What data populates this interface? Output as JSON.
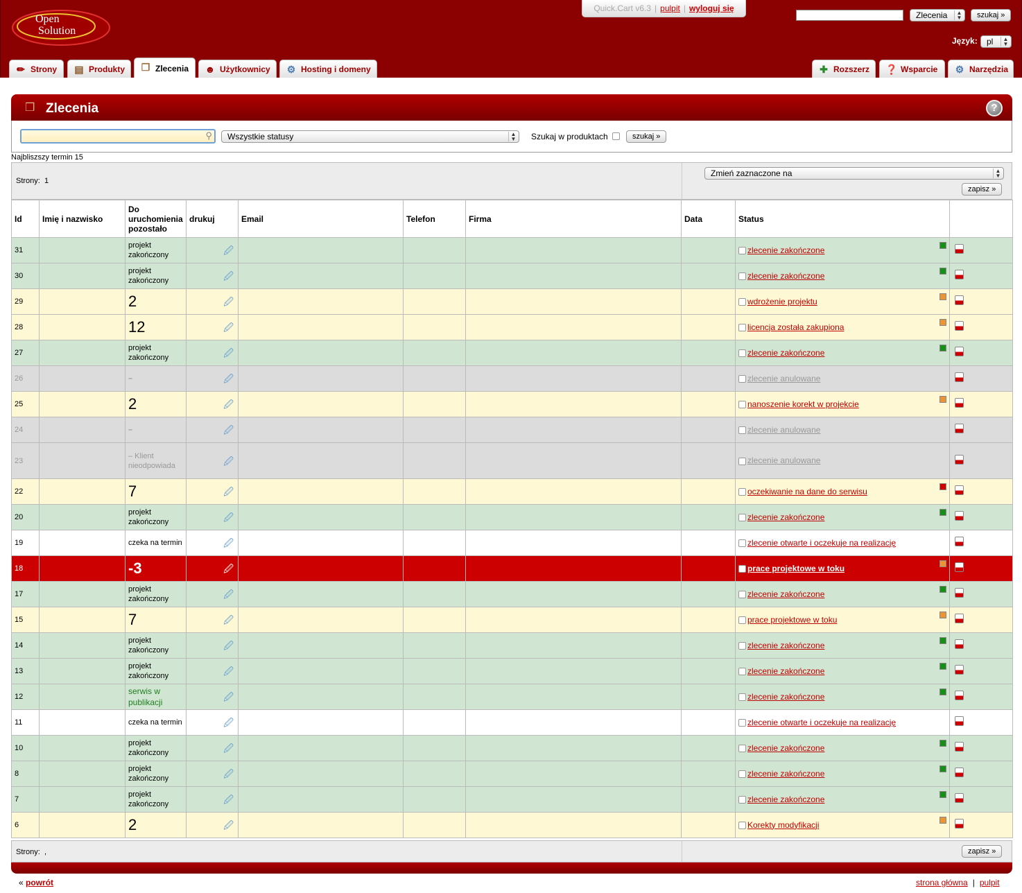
{
  "header": {
    "logo_text": "Open Solution",
    "version_bar": {
      "version": "Quick.Cart v6.3",
      "pulpit": "pulpit",
      "logout": "wyloguj się"
    },
    "search_select": "Zlecenia",
    "search_button": "szukaj »",
    "language_label": "Język:",
    "language_value": "pl"
  },
  "tabs_left": [
    {
      "label": "Strony",
      "icon": "pencil-icon"
    },
    {
      "label": "Produkty",
      "icon": "box-icon"
    },
    {
      "label": "Zlecenia",
      "icon": "package-icon",
      "active": true
    },
    {
      "label": "Użytkownicy",
      "icon": "user-icon"
    },
    {
      "label": "Hosting i domeny",
      "icon": "gears-icon"
    }
  ],
  "tabs_right": [
    {
      "label": "Rozszerz",
      "icon": "puzzle-icon"
    },
    {
      "label": "Wsparcie",
      "icon": "help-icon"
    },
    {
      "label": "Narzędzia",
      "icon": "tools-icon"
    }
  ],
  "panel": {
    "title": "Zlecenia",
    "help": "?",
    "filter": {
      "search_value": "",
      "status_select": "Wszystkie statusy",
      "search_in_products_label": "Szukaj w produktach",
      "search_button": "szukaj »"
    },
    "nearest_deadline": "Najbliszszy termin 15",
    "pages_label": "Strony:",
    "pages_value": "1",
    "pages_bottom_value": ",",
    "change_selected": "Zmień zaznaczone na",
    "save_button": "zapisz »"
  },
  "table": {
    "headers": {
      "id": "Id",
      "name": "Imię i nazwisko",
      "remaining": "Do uruchomienia pozostało",
      "print": "drukuj",
      "email": "Email",
      "phone": "Telefon",
      "company": "Firma",
      "date": "Data",
      "status": "Status"
    },
    "rows": [
      {
        "id": "31",
        "remaining": "projekt zakończony",
        "kind": "text",
        "status": "zlecenie zakończone",
        "color": "#1a8c1a",
        "row": "g"
      },
      {
        "id": "30",
        "remaining": "projekt zakończony",
        "kind": "text",
        "status": "zlecenie zakończone",
        "color": "#1a8c1a",
        "row": "g"
      },
      {
        "id": "29",
        "remaining": "2",
        "kind": "big",
        "status": "wdrożenie projektu",
        "color": "#e8953a",
        "row": "y"
      },
      {
        "id": "28",
        "remaining": "12",
        "kind": "big",
        "status": "licencja została zakupiona",
        "color": "#e8953a",
        "row": "y"
      },
      {
        "id": "27",
        "remaining": "projekt zakończony",
        "kind": "text",
        "status": "zlecenie zakończone",
        "color": "#1a8c1a",
        "row": "g"
      },
      {
        "id": "26",
        "remaining": "–",
        "kind": "dash",
        "status": "zlecenie anulowane",
        "color": "",
        "row": "x"
      },
      {
        "id": "25",
        "remaining": "2",
        "kind": "big",
        "status": "nanoszenie korekt w projekcie",
        "color": "#e8953a",
        "row": "y"
      },
      {
        "id": "24",
        "remaining": "–",
        "kind": "dash",
        "status": "zlecenie anulowane",
        "color": "",
        "row": "x"
      },
      {
        "id": "23",
        "remaining": "– Klient nieodpowiada",
        "kind": "dashtext",
        "status": "zlecenie anulowane",
        "color": "",
        "row": "x tall"
      },
      {
        "id": "22",
        "remaining": "7",
        "kind": "big",
        "status": "oczekiwanie na dane do serwisu",
        "color": "#cc0000",
        "row": "y"
      },
      {
        "id": "20",
        "remaining": "projekt zakończony",
        "kind": "text",
        "status": "zlecenie zakończone",
        "color": "#1a8c1a",
        "row": "g"
      },
      {
        "id": "19",
        "remaining": "czeka na termin",
        "kind": "text",
        "status": "zlecenie otwarte i oczekuje na realizację",
        "color": "",
        "row": "w"
      },
      {
        "id": "18",
        "remaining": "-3",
        "kind": "big",
        "status": "prace projektowe w toku",
        "color": "#e8953a",
        "row": "r"
      },
      {
        "id": "17",
        "remaining": "projekt zakończony",
        "kind": "text",
        "status": "zlecenie zakończone",
        "color": "#1a8c1a",
        "row": "g"
      },
      {
        "id": "15",
        "remaining": "7",
        "kind": "big",
        "status": "prace projektowe w toku",
        "color": "#e8953a",
        "row": "y"
      },
      {
        "id": "14",
        "remaining": "projekt zakończony",
        "kind": "text",
        "status": "zlecenie zakończone",
        "color": "#1a8c1a",
        "row": "g"
      },
      {
        "id": "13",
        "remaining": "projekt zakończony",
        "kind": "text",
        "status": "zlecenie zakończone",
        "color": "#1a8c1a",
        "row": "g"
      },
      {
        "id": "12",
        "remaining": "serwis w publikacji",
        "kind": "green",
        "status": "zlecenie zakończone",
        "color": "#1a8c1a",
        "row": "g"
      },
      {
        "id": "11",
        "remaining": "czeka na termin",
        "kind": "text",
        "status": "zlecenie otwarte i oczekuje na realizację",
        "color": "",
        "row": "w"
      },
      {
        "id": "10",
        "remaining": "projekt zakończony",
        "kind": "text",
        "status": "zlecenie zakończone",
        "color": "#1a8c1a",
        "row": "g"
      },
      {
        "id": "8",
        "remaining": "projekt zakończony",
        "kind": "text",
        "status": "zlecenie zakończone",
        "color": "#1a8c1a",
        "row": "g"
      },
      {
        "id": "7",
        "remaining": "projekt zakończony",
        "kind": "text",
        "status": "zlecenie zakończone",
        "color": "#1a8c1a",
        "row": "g"
      },
      {
        "id": "6",
        "remaining": "2",
        "kind": "big",
        "status": "Korekty modyfikacji",
        "color": "#e8953a",
        "row": "y"
      }
    ]
  },
  "footer": {
    "back_prefix": "«",
    "back": "powrót",
    "home": "strona główna",
    "sep": "|",
    "pulpit": "pulpit"
  }
}
